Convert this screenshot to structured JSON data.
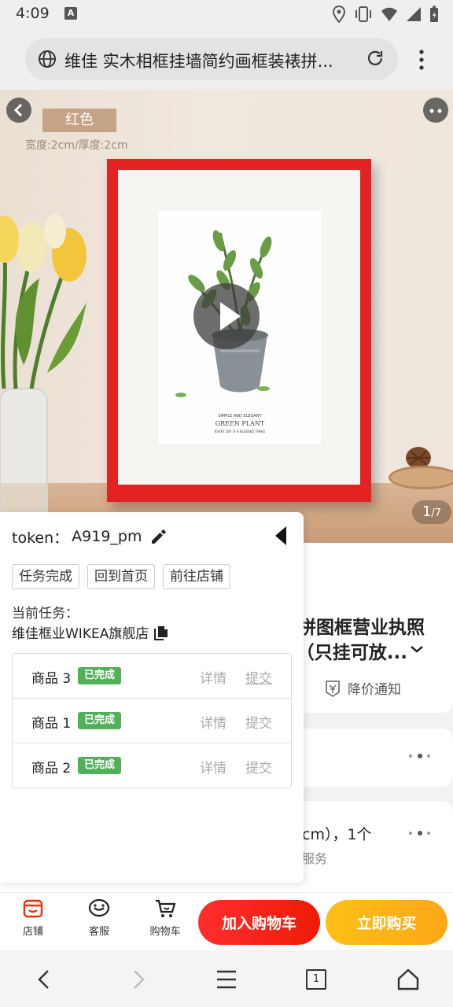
{
  "status_bar": {
    "time": "4:09",
    "a_badge": "A",
    "icons": [
      "location-icon",
      "vibrate-icon",
      "wifi-icon",
      "signal-icon",
      "battery-icon"
    ]
  },
  "browser": {
    "url_text": "维佳 实木相框挂墙简约画框装裱拼...",
    "icons": [
      "globe-icon",
      "reload-icon",
      "more-vert-icon"
    ]
  },
  "hero": {
    "color_tag": "红色",
    "size_note": "宽度:2cm/厚度:2cm",
    "art_caption_small": "SIMPLE AND ELEGANT",
    "art_caption_title": "GREEN PLANT",
    "art_caption_sub": "EVERY DAY IS A BLESSED THING",
    "page_current": "1",
    "page_total": "/7"
  },
  "content": {
    "title_line1": "拼图框营业执照",
    "title_line2": "（只挂可放...",
    "price_notice": "降价通知",
    "spec_text": "cm），1个",
    "spec_sub": "服务"
  },
  "panel": {
    "token_label": "token：",
    "token_value": "A919_pm",
    "buttons": {
      "task_complete": "任务完成",
      "back_home": "回到首页",
      "go_store": "前往店铺"
    },
    "current_task_label": "当前任务：",
    "store_name": "维佳框业WIKEA旗舰店",
    "tasks": [
      {
        "name": "商品 3",
        "status": "已完成",
        "detail": "详情",
        "submit": "提交"
      },
      {
        "name": "商品 1",
        "status": "已完成",
        "detail": "详情",
        "submit": "提交"
      },
      {
        "name": "商品 2",
        "status": "已完成",
        "detail": "详情",
        "submit": "提交"
      }
    ]
  },
  "bottom_bar": {
    "store": "店铺",
    "service": "客服",
    "cart": "购物车",
    "add_to_cart": "加入购物车",
    "buy_now": "立即购买"
  },
  "nav": {
    "tab_count": "1"
  },
  "colors": {
    "accent_red": "#ef1a06",
    "accent_yellow": "#fca816",
    "badge_green": "#52b05a"
  }
}
